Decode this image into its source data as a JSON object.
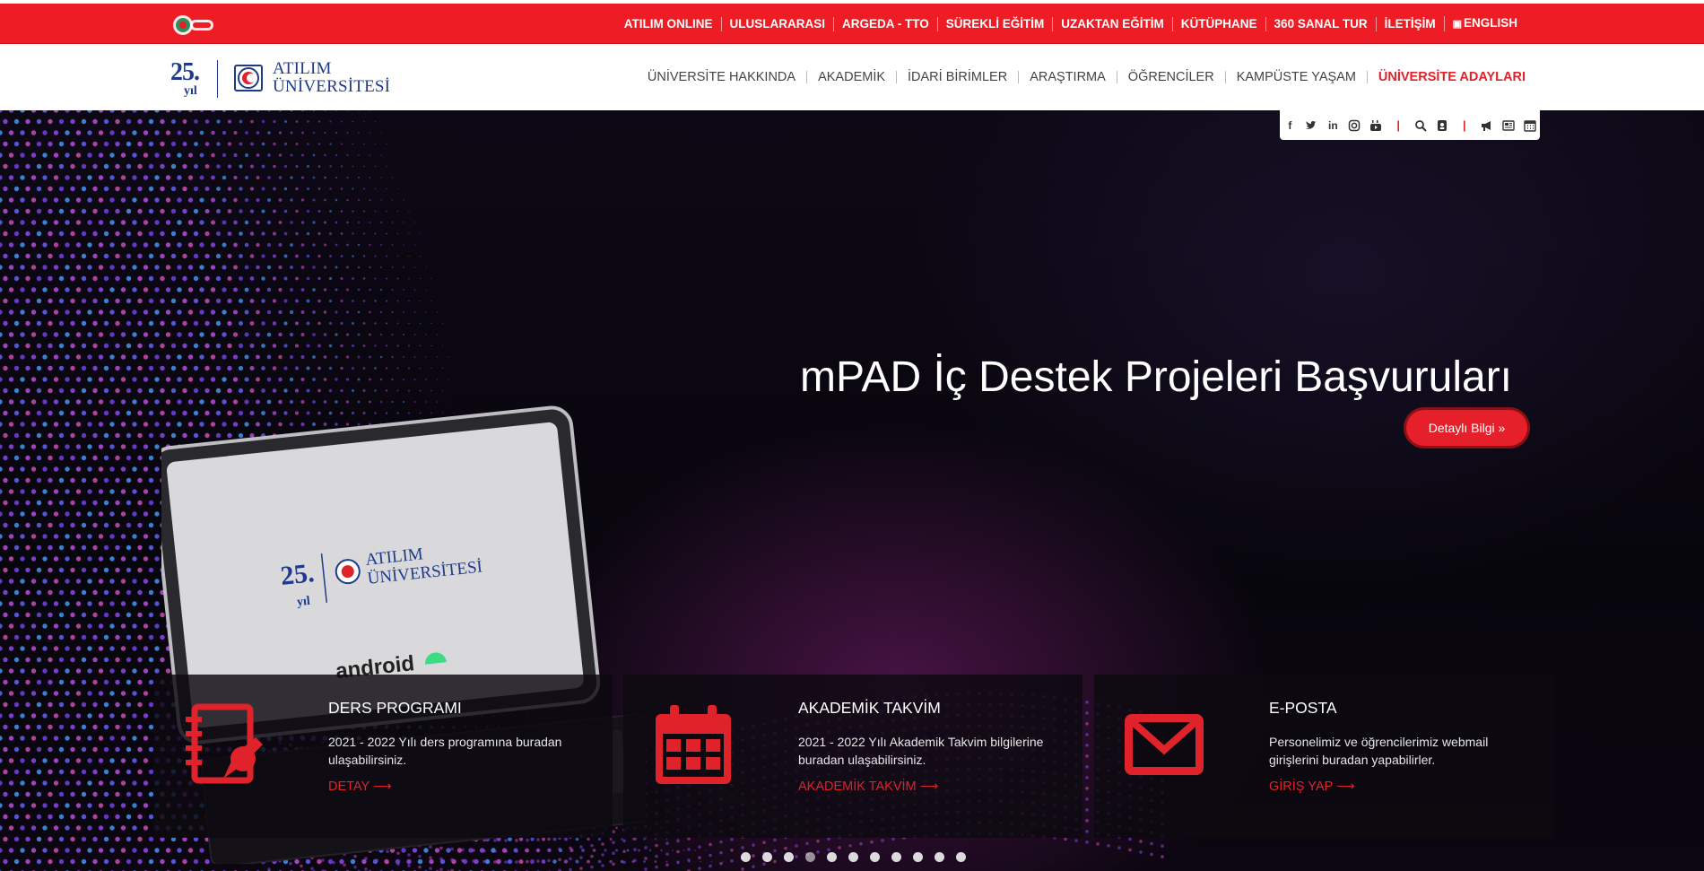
{
  "topbar": {
    "badge_icon": "anniversary-badge-icon",
    "items": [
      {
        "label": "ATILIM ONLINE"
      },
      {
        "label": "ULUSLARARASI"
      },
      {
        "label": "ARGEDA - TTO"
      },
      {
        "label": "SÜREKLİ EĞİTİM"
      },
      {
        "label": "UZAKTAN EĞİTİM"
      },
      {
        "label": "KÜTÜPHANE"
      },
      {
        "label": "360 SANAL TUR"
      },
      {
        "label": "İLETİŞİM"
      }
    ],
    "language": {
      "label": "ENGLISH",
      "icon": "language-icon"
    },
    "color": "#ee1c25"
  },
  "header": {
    "logo": {
      "years": "25.",
      "yil": "yıl",
      "name_line1": "ATILIM",
      "name_line2": "ÜNİVERSİTESİ"
    },
    "nav": [
      {
        "label": "ÜNİVERSİTE HAKKINDA"
      },
      {
        "label": "AKADEMİK"
      },
      {
        "label": "İDARİ BİRİMLER"
      },
      {
        "label": "ARAŞTIRMA"
      },
      {
        "label": "ÖĞRENCİLER"
      },
      {
        "label": "KAMPÜSTE YAŞAM"
      },
      {
        "label": "ÜNİVERSİTE ADAYLARI"
      }
    ]
  },
  "social_box": {
    "icons": [
      "facebook-icon",
      "twitter-icon",
      "linkedin-icon",
      "instagram-icon",
      "youtube-icon",
      "search-icon",
      "contacts-icon",
      "announcement-icon",
      "news-icon",
      "calendar-icon"
    ]
  },
  "hero": {
    "title": "mPAD İç Destek Projeleri Başvuruları",
    "button_label": "Detaylı Bilgi »",
    "tablet_screen": {
      "years": "25.",
      "yil": "yıl",
      "name_line1": "ATILIM",
      "name_line2": "ÜNİVERSİTESİ",
      "android": "android"
    },
    "slide_count": 11,
    "active_slide": 4
  },
  "cards": [
    {
      "icon": "notebook-pen-icon",
      "title": "DERS PROGRAMI",
      "text": "2021 - 2022 Yılı ders programına buradan ulaşabilirsiniz.",
      "link": "DETAY ⟶"
    },
    {
      "icon": "calendar-icon",
      "title": "AKADEMİK TAKVİM",
      "text": "2021 - 2022 Yılı Akademik Takvim bilgilerine buradan ulaşabilirsiniz.",
      "link": "AKADEMİK TAKVİM ⟶"
    },
    {
      "icon": "envelope-icon",
      "title": "E-POSTA",
      "text": "Personelimiz ve öğrencilerimiz webmail girişlerini buradan yapabilirler.",
      "link": "GİRİŞ YAP ⟶"
    }
  ],
  "colors": {
    "accent": "#e0222b",
    "brand_blue": "#1f3a8a"
  }
}
